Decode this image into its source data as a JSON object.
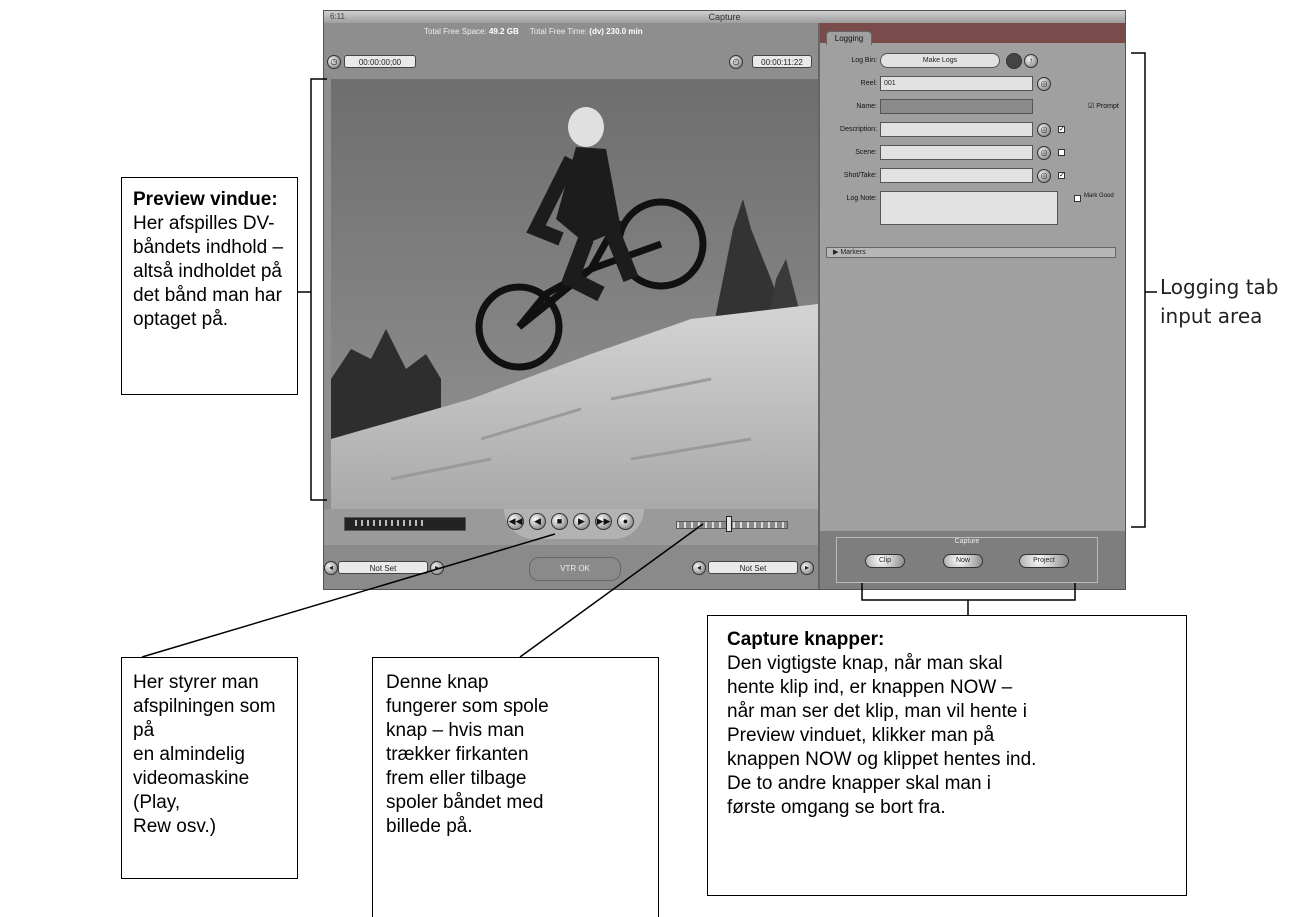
{
  "capture_window": {
    "title": "Capture",
    "window_label": "6:11",
    "free_space_label": "Total Free Space:",
    "free_space_value": "49.2 GB",
    "free_time_label": "Total Free Time:",
    "free_time_value": "(dv) 230.0 min",
    "timecode_left": "00:00:00;00",
    "timecode_right": "00:00:11:22",
    "in_field": "Not Set",
    "out_field": "Not Set",
    "vtr_status": "VTR OK",
    "transport_buttons": [
      "◀◀",
      "◀",
      "■",
      "▶",
      "▶▶",
      "●"
    ]
  },
  "logging_panel": {
    "tab_label": "Logging",
    "fields": [
      {
        "label": "Log Bin:",
        "value": "Make Logs"
      },
      {
        "label": "Reel:",
        "value": "001"
      },
      {
        "label": "Name:",
        "value": ""
      },
      {
        "label": "Description:",
        "value": ""
      },
      {
        "label": "Scene:",
        "value": ""
      },
      {
        "label": "Shot/Take:",
        "value": ""
      },
      {
        "label": "Log Note:",
        "value": ""
      }
    ],
    "prompt_label": "Prompt",
    "mark_good_label": "Mark Good",
    "markers_label": "▶ Markers"
  },
  "capture_section": {
    "title": "Capture",
    "buttons": [
      "Clip",
      "Now",
      "Project"
    ]
  },
  "annotations": {
    "preview": {
      "heading": "Preview vindue:",
      "body": "Her afspilles DV-\nbåndets indhold –\naltså indholdet på\ndet bånd man har\noptaget på."
    },
    "logging_tab": "Logging tab\ninput area",
    "playback": "Her styrer man\nafspilningen som på\nen almindelig\nvideomaskine (Play,\nRew osv.)",
    "shuttle": "Denne knap\nfungerer som spole\nknap – hvis man\ntrækker firkanten\nfrem eller tilbage\nspoler båndet med\nbillede på.",
    "capture_buttons": {
      "heading": "Capture knapper:",
      "body": "Den vigtigste knap, når man skal\nhente klip ind, er knappen NOW –\nnår man ser det klip, man vil hente i\nPreview vinduet, klikker man på\nknappen NOW og klippet hentes ind.\nDe to andre knapper skal man i\nførste omgang se bort fra."
    }
  }
}
